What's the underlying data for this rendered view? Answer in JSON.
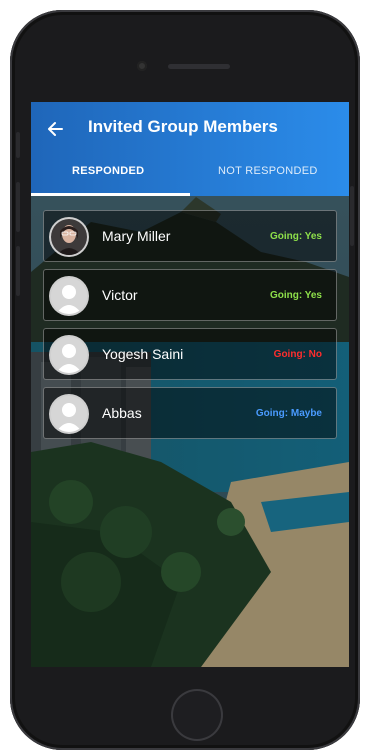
{
  "appbar": {
    "title": "Invited Group Members",
    "back_icon": "arrow-left-icon"
  },
  "tabs": [
    {
      "label": "RESPONDED",
      "active": true
    },
    {
      "label": "NOT RESPONDED",
      "active": false
    }
  ],
  "members": [
    {
      "name": "Mary Miller",
      "status": "Going: Yes",
      "status_color": "#8ee04a",
      "avatar": "photo"
    },
    {
      "name": "Victor",
      "status": "Going: Yes",
      "status_color": "#8ee04a",
      "avatar": "placeholder"
    },
    {
      "name": "Yogesh Saini",
      "status": "Going: No",
      "status_color": "#ff2d2d",
      "avatar": "placeholder"
    },
    {
      "name": "Abbas",
      "status": "Going: Maybe",
      "status_color": "#4a9bff",
      "avatar": "placeholder"
    }
  ],
  "colors": {
    "appbar_gradient_start": "#1f66b9",
    "appbar_gradient_end": "#2b8cea"
  }
}
